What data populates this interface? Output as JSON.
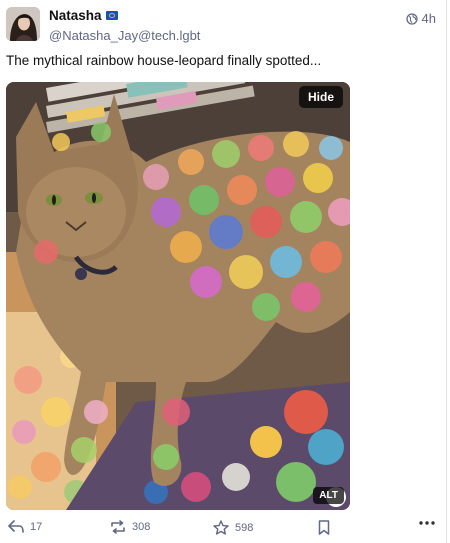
{
  "author": {
    "display_name": "Natasha",
    "handle": "@Natasha_Jay@tech.lgbt",
    "avatar_icon": "avatar-photo",
    "flag_icon": "eu-flag-icon"
  },
  "post": {
    "time": "4h",
    "visibility_icon": "globe-icon",
    "text": "The mythical rainbow house-leopard finally spotted...",
    "media": {
      "description": "cat with rainbow polka-dot light pattern",
      "hide_label": "Hide",
      "alt_label": "ALT"
    }
  },
  "actions": {
    "reply_count": "17",
    "boost_count": "308",
    "favourite_count": "598",
    "reply_icon": "reply-icon",
    "boost_icon": "boost-icon",
    "favourite_icon": "star-icon",
    "bookmark_icon": "bookmark-icon",
    "more_icon": "more-icon"
  },
  "colors": {
    "muted": "#606984",
    "text": "#111111"
  }
}
